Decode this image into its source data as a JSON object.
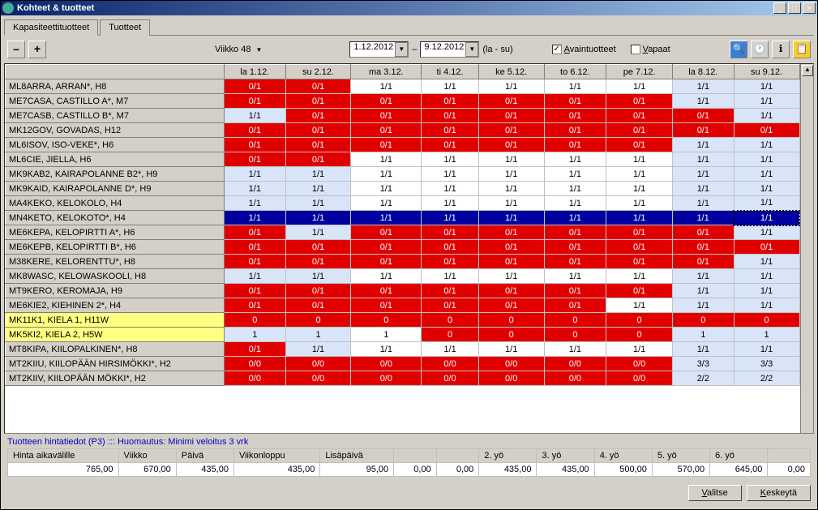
{
  "window": {
    "title": "Kohteet & tuotteet"
  },
  "tabs": [
    {
      "label": "Kapasiteettituotteet",
      "active": true
    },
    {
      "label": "Tuotteet",
      "active": false
    }
  ],
  "toolbar": {
    "minus": "–",
    "plus": "+",
    "week_label": "Viikko 48",
    "date_from": "1.12.2012",
    "date_to": "9.12.2012",
    "range_suffix": "(la - su)",
    "chk_avain": "Avaintuotteet",
    "chk_avain_checked": true,
    "chk_vapaat": "Vapaat",
    "chk_vapaat_checked": false
  },
  "grid": {
    "headers": [
      "",
      "la 1.12.",
      "su 2.12.",
      "ma 3.12.",
      "ti 4.12.",
      "ke 5.12.",
      "to 6.12.",
      "pe 7.12.",
      "la 8.12.",
      "su 9.12."
    ],
    "rows": [
      {
        "name": "ML8ARRA, ARRAN*, H8",
        "cells": [
          {
            "v": "0/1",
            "c": "red"
          },
          {
            "v": "0/1",
            "c": "red"
          },
          {
            "v": "1/1",
            "c": "white"
          },
          {
            "v": "1/1",
            "c": "white"
          },
          {
            "v": "1/1",
            "c": "white"
          },
          {
            "v": "1/1",
            "c": "white"
          },
          {
            "v": "1/1",
            "c": "white"
          },
          {
            "v": "1/1",
            "c": "ltblue"
          },
          {
            "v": "1/1",
            "c": "ltblue"
          }
        ]
      },
      {
        "name": "ME7CASA, CASTILLO A*, M7",
        "cells": [
          {
            "v": "0/1",
            "c": "red"
          },
          {
            "v": "0/1",
            "c": "red"
          },
          {
            "v": "0/1",
            "c": "red"
          },
          {
            "v": "0/1",
            "c": "red"
          },
          {
            "v": "0/1",
            "c": "red"
          },
          {
            "v": "0/1",
            "c": "red"
          },
          {
            "v": "0/1",
            "c": "red"
          },
          {
            "v": "1/1",
            "c": "ltblue"
          },
          {
            "v": "1/1",
            "c": "ltblue"
          }
        ]
      },
      {
        "name": "ME7CASB, CASTILLO B*, M7",
        "cells": [
          {
            "v": "1/1",
            "c": "ltblue"
          },
          {
            "v": "0/1",
            "c": "red"
          },
          {
            "v": "0/1",
            "c": "red"
          },
          {
            "v": "0/1",
            "c": "red"
          },
          {
            "v": "0/1",
            "c": "red"
          },
          {
            "v": "0/1",
            "c": "red"
          },
          {
            "v": "0/1",
            "c": "red"
          },
          {
            "v": "0/1",
            "c": "red"
          },
          {
            "v": "1/1",
            "c": "ltblue"
          }
        ]
      },
      {
        "name": "MK12GOV, GOVADAS, H12",
        "cells": [
          {
            "v": "0/1",
            "c": "red"
          },
          {
            "v": "0/1",
            "c": "red"
          },
          {
            "v": "0/1",
            "c": "red"
          },
          {
            "v": "0/1",
            "c": "red"
          },
          {
            "v": "0/1",
            "c": "red"
          },
          {
            "v": "0/1",
            "c": "red"
          },
          {
            "v": "0/1",
            "c": "red"
          },
          {
            "v": "0/1",
            "c": "red"
          },
          {
            "v": "0/1",
            "c": "red"
          }
        ]
      },
      {
        "name": "ML6ISOV, ISO-VEKE*, H6",
        "cells": [
          {
            "v": "0/1",
            "c": "red"
          },
          {
            "v": "0/1",
            "c": "red"
          },
          {
            "v": "0/1",
            "c": "red"
          },
          {
            "v": "0/1",
            "c": "red"
          },
          {
            "v": "0/1",
            "c": "red"
          },
          {
            "v": "0/1",
            "c": "red"
          },
          {
            "v": "0/1",
            "c": "red"
          },
          {
            "v": "1/1",
            "c": "ltblue"
          },
          {
            "v": "1/1",
            "c": "ltblue"
          }
        ]
      },
      {
        "name": "ML6CIE, JIELLA, H6",
        "cells": [
          {
            "v": "0/1",
            "c": "red"
          },
          {
            "v": "0/1",
            "c": "red"
          },
          {
            "v": "1/1",
            "c": "white"
          },
          {
            "v": "1/1",
            "c": "white"
          },
          {
            "v": "1/1",
            "c": "white"
          },
          {
            "v": "1/1",
            "c": "white"
          },
          {
            "v": "1/1",
            "c": "white"
          },
          {
            "v": "1/1",
            "c": "ltblue"
          },
          {
            "v": "1/1",
            "c": "ltblue"
          }
        ]
      },
      {
        "name": "MK9KAB2, KAIRAPOLANNE B2*, H9",
        "cells": [
          {
            "v": "1/1",
            "c": "ltblue"
          },
          {
            "v": "1/1",
            "c": "ltblue"
          },
          {
            "v": "1/1",
            "c": "white"
          },
          {
            "v": "1/1",
            "c": "white"
          },
          {
            "v": "1/1",
            "c": "white"
          },
          {
            "v": "1/1",
            "c": "white"
          },
          {
            "v": "1/1",
            "c": "white"
          },
          {
            "v": "1/1",
            "c": "ltblue"
          },
          {
            "v": "1/1",
            "c": "ltblue"
          }
        ]
      },
      {
        "name": "MK9KAID, KAIRAPOLANNE D*, H9",
        "cells": [
          {
            "v": "1/1",
            "c": "ltblue"
          },
          {
            "v": "1/1",
            "c": "ltblue"
          },
          {
            "v": "1/1",
            "c": "white"
          },
          {
            "v": "1/1",
            "c": "white"
          },
          {
            "v": "1/1",
            "c": "white"
          },
          {
            "v": "1/1",
            "c": "white"
          },
          {
            "v": "1/1",
            "c": "white"
          },
          {
            "v": "1/1",
            "c": "ltblue"
          },
          {
            "v": "1/1",
            "c": "ltblue"
          }
        ]
      },
      {
        "name": "MA4KEKO, KELOKOLO, H4",
        "cells": [
          {
            "v": "1/1",
            "c": "ltblue"
          },
          {
            "v": "1/1",
            "c": "ltblue"
          },
          {
            "v": "1/1",
            "c": "white"
          },
          {
            "v": "1/1",
            "c": "white"
          },
          {
            "v": "1/1",
            "c": "white"
          },
          {
            "v": "1/1",
            "c": "white"
          },
          {
            "v": "1/1",
            "c": "white"
          },
          {
            "v": "1/1",
            "c": "ltblue"
          },
          {
            "v": "1/1",
            "c": "ltblue"
          }
        ]
      },
      {
        "name": "MN4KETO, KELOKOTO*, H4",
        "cells": [
          {
            "v": "1/1",
            "c": "blue"
          },
          {
            "v": "1/1",
            "c": "blue"
          },
          {
            "v": "1/1",
            "c": "blue"
          },
          {
            "v": "1/1",
            "c": "blue"
          },
          {
            "v": "1/1",
            "c": "blue"
          },
          {
            "v": "1/1",
            "c": "blue"
          },
          {
            "v": "1/1",
            "c": "blue"
          },
          {
            "v": "1/1",
            "c": "blue"
          },
          {
            "v": "1/1",
            "c": "blue",
            "sel": true
          }
        ]
      },
      {
        "name": "ME6KEPA, KELOPIRTTI A*, H6",
        "cells": [
          {
            "v": "0/1",
            "c": "red"
          },
          {
            "v": "1/1",
            "c": "ltblue"
          },
          {
            "v": "0/1",
            "c": "red"
          },
          {
            "v": "0/1",
            "c": "red"
          },
          {
            "v": "0/1",
            "c": "red"
          },
          {
            "v": "0/1",
            "c": "red"
          },
          {
            "v": "0/1",
            "c": "red"
          },
          {
            "v": "0/1",
            "c": "red"
          },
          {
            "v": "1/1",
            "c": "ltblue"
          }
        ]
      },
      {
        "name": "ME6KEPB, KELOPIRTTI B*, H6",
        "cells": [
          {
            "v": "0/1",
            "c": "red"
          },
          {
            "v": "0/1",
            "c": "red"
          },
          {
            "v": "0/1",
            "c": "red"
          },
          {
            "v": "0/1",
            "c": "red"
          },
          {
            "v": "0/1",
            "c": "red"
          },
          {
            "v": "0/1",
            "c": "red"
          },
          {
            "v": "0/1",
            "c": "red"
          },
          {
            "v": "0/1",
            "c": "red"
          },
          {
            "v": "0/1",
            "c": "red"
          }
        ]
      },
      {
        "name": "M38KERE, KELORENTTU*, H8",
        "cells": [
          {
            "v": "0/1",
            "c": "red"
          },
          {
            "v": "0/1",
            "c": "red"
          },
          {
            "v": "0/1",
            "c": "red"
          },
          {
            "v": "0/1",
            "c": "red"
          },
          {
            "v": "0/1",
            "c": "red"
          },
          {
            "v": "0/1",
            "c": "red"
          },
          {
            "v": "0/1",
            "c": "red"
          },
          {
            "v": "0/1",
            "c": "red"
          },
          {
            "v": "1/1",
            "c": "ltblue"
          }
        ]
      },
      {
        "name": "MK8WASC, KELOWASKOOLI, H8",
        "cells": [
          {
            "v": "1/1",
            "c": "ltblue"
          },
          {
            "v": "1/1",
            "c": "ltblue"
          },
          {
            "v": "1/1",
            "c": "white"
          },
          {
            "v": "1/1",
            "c": "white"
          },
          {
            "v": "1/1",
            "c": "white"
          },
          {
            "v": "1/1",
            "c": "white"
          },
          {
            "v": "1/1",
            "c": "white"
          },
          {
            "v": "1/1",
            "c": "ltblue"
          },
          {
            "v": "1/1",
            "c": "ltblue"
          }
        ]
      },
      {
        "name": "MT9KERO, KEROMAJA, H9",
        "cells": [
          {
            "v": "0/1",
            "c": "red"
          },
          {
            "v": "0/1",
            "c": "red"
          },
          {
            "v": "0/1",
            "c": "red"
          },
          {
            "v": "0/1",
            "c": "red"
          },
          {
            "v": "0/1",
            "c": "red"
          },
          {
            "v": "0/1",
            "c": "red"
          },
          {
            "v": "0/1",
            "c": "red"
          },
          {
            "v": "1/1",
            "c": "ltblue"
          },
          {
            "v": "1/1",
            "c": "ltblue"
          }
        ]
      },
      {
        "name": "ME6KIE2, KIEHINEN 2*, H4",
        "cells": [
          {
            "v": "0/1",
            "c": "red"
          },
          {
            "v": "0/1",
            "c": "red"
          },
          {
            "v": "0/1",
            "c": "red"
          },
          {
            "v": "0/1",
            "c": "red"
          },
          {
            "v": "0/1",
            "c": "red"
          },
          {
            "v": "0/1",
            "c": "red"
          },
          {
            "v": "1/1",
            "c": "white"
          },
          {
            "v": "1/1",
            "c": "ltblue"
          },
          {
            "v": "1/1",
            "c": "ltblue"
          }
        ]
      },
      {
        "name": "MK11K1, KIELA 1, H11W",
        "highlight": true,
        "cells": [
          {
            "v": "0",
            "c": "red"
          },
          {
            "v": "0",
            "c": "red"
          },
          {
            "v": "0",
            "c": "red"
          },
          {
            "v": "0",
            "c": "red"
          },
          {
            "v": "0",
            "c": "red"
          },
          {
            "v": "0",
            "c": "red"
          },
          {
            "v": "0",
            "c": "red"
          },
          {
            "v": "0",
            "c": "red"
          },
          {
            "v": "0",
            "c": "red"
          }
        ]
      },
      {
        "name": "MK5KI2, KIELA 2, H5W",
        "highlight": true,
        "cells": [
          {
            "v": "1",
            "c": "ltblue"
          },
          {
            "v": "1",
            "c": "ltblue"
          },
          {
            "v": "1",
            "c": "white"
          },
          {
            "v": "0",
            "c": "red"
          },
          {
            "v": "0",
            "c": "red"
          },
          {
            "v": "0",
            "c": "red"
          },
          {
            "v": "0",
            "c": "red"
          },
          {
            "v": "1",
            "c": "ltblue"
          },
          {
            "v": "1",
            "c": "ltblue"
          }
        ]
      },
      {
        "name": "MT8KIPA, KIILOPALKINEN*, H8",
        "cells": [
          {
            "v": "0/1",
            "c": "red"
          },
          {
            "v": "1/1",
            "c": "ltblue"
          },
          {
            "v": "1/1",
            "c": "white"
          },
          {
            "v": "1/1",
            "c": "white"
          },
          {
            "v": "1/1",
            "c": "white"
          },
          {
            "v": "1/1",
            "c": "white"
          },
          {
            "v": "1/1",
            "c": "white"
          },
          {
            "v": "1/1",
            "c": "ltblue"
          },
          {
            "v": "1/1",
            "c": "ltblue"
          }
        ]
      },
      {
        "name": "MT2KIIU, KIILOPÄÄN HIRSIMÖKKI*, H2",
        "cells": [
          {
            "v": "0/0",
            "c": "red"
          },
          {
            "v": "0/0",
            "c": "red"
          },
          {
            "v": "0/0",
            "c": "red"
          },
          {
            "v": "0/0",
            "c": "red"
          },
          {
            "v": "0/0",
            "c": "red"
          },
          {
            "v": "0/0",
            "c": "red"
          },
          {
            "v": "0/0",
            "c": "red"
          },
          {
            "v": "3/3",
            "c": "ltblue"
          },
          {
            "v": "3/3",
            "c": "ltblue"
          }
        ]
      },
      {
        "name": "MT2KIIV, KIILOPÄÄN MÖKKI*, H2",
        "cells": [
          {
            "v": "0/0",
            "c": "red"
          },
          {
            "v": "0/0",
            "c": "red"
          },
          {
            "v": "0/0",
            "c": "red"
          },
          {
            "v": "0/0",
            "c": "red"
          },
          {
            "v": "0/0",
            "c": "red"
          },
          {
            "v": "0/0",
            "c": "red"
          },
          {
            "v": "0/0",
            "c": "red"
          },
          {
            "v": "2/2",
            "c": "ltblue"
          },
          {
            "v": "2/2",
            "c": "ltblue"
          }
        ]
      }
    ]
  },
  "price": {
    "label": "Tuotteen hintatiedot (P3) ::: Huomautus: Minimi veloitus 3 vrk",
    "headers": [
      "Hinta aikavälille",
      "Viikko",
      "Päivä",
      "Viikonloppu",
      "Lisäpäivä",
      "",
      "",
      "2. yö",
      "3. yö",
      "4. yö",
      "5. yö",
      "6. yö",
      ""
    ],
    "values": [
      "765,00",
      "670,00",
      "435,00",
      "435,00",
      "95,00",
      "0,00",
      "0,00",
      "435,00",
      "435,00",
      "500,00",
      "570,00",
      "645,00",
      "0,00"
    ]
  },
  "buttons": {
    "valitse": "Valitse",
    "keskeyta": "Keskeytä"
  }
}
